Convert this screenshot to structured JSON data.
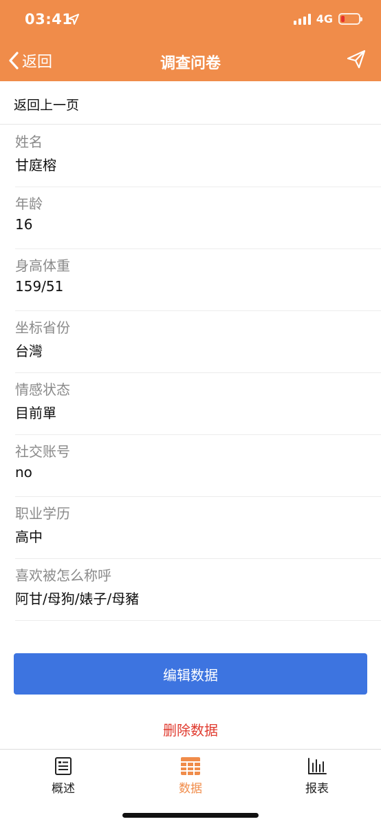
{
  "status_bar": {
    "time": "03:41",
    "network": "4G"
  },
  "nav": {
    "back_label": "返回",
    "title": "调查问卷"
  },
  "prev_page_link": "返回上一页",
  "fields": [
    {
      "label": "姓名",
      "value": "甘庭榕"
    },
    {
      "label": "年龄",
      "value": "16"
    },
    {
      "label": "身高体重",
      "value": "159/51"
    },
    {
      "label": "坐标省份",
      "value": "台灣"
    },
    {
      "label": "情感状态",
      "value": "目前單"
    },
    {
      "label": "社交账号",
      "value": "no"
    },
    {
      "label": "职业学历",
      "value": "高中"
    },
    {
      "label": "喜欢被怎么称呼",
      "value": "阿甘/母狗/婊子/母豬"
    }
  ],
  "actions": {
    "edit_label": "编辑数据",
    "delete_label": "删除数据"
  },
  "tabs": [
    {
      "label": "概述",
      "icon": "document-icon",
      "active": false
    },
    {
      "label": "数据",
      "icon": "grid-icon",
      "active": true
    },
    {
      "label": "报表",
      "icon": "bar-chart-icon",
      "active": false
    }
  ],
  "colors": {
    "accent": "#F08C4A",
    "primary_button": "#3D74E0",
    "danger": "#E03A2E"
  }
}
